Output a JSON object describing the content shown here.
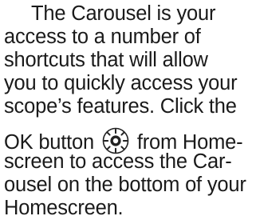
{
  "paragraph": {
    "line1": "The Carousel is your",
    "line2": "access to a number of",
    "line3": "shortcuts that will allow",
    "line4": "you to quickly access your",
    "line5": "scope’s features. Click the",
    "line6_before_icon": "OK button",
    "line6_after_icon": "from Home-",
    "line7": "screen to access the Car-",
    "line8": "ousel on the bottom of your",
    "line9": "Homescreen."
  },
  "icons": {
    "ok_button": "ok-button-icon"
  }
}
